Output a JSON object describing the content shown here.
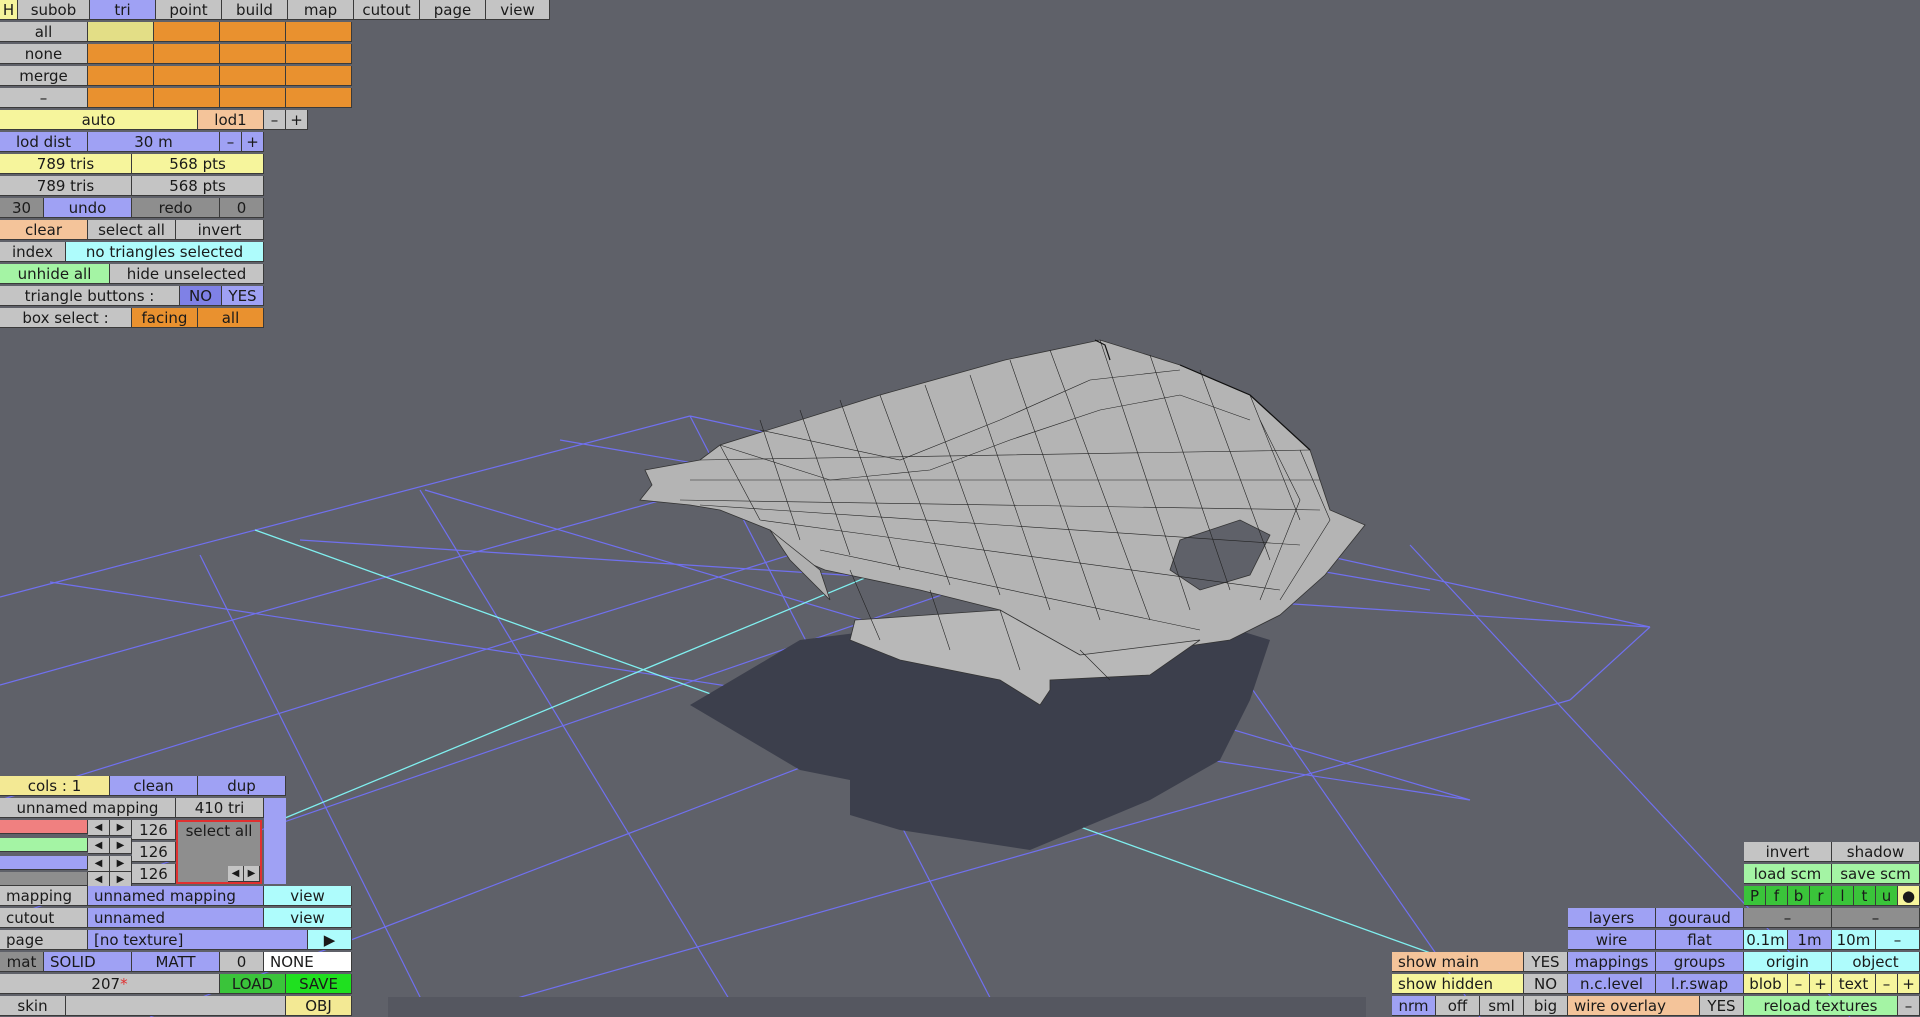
{
  "toolbar": {
    "h": "H",
    "tabs": [
      "subob",
      "tri",
      "point",
      "build",
      "map",
      "cutout",
      "page",
      "view"
    ]
  },
  "selection": {
    "rows": [
      "all",
      "none",
      "merge",
      "–"
    ],
    "lod_auto": "auto",
    "lod_name": "lod1",
    "minus": "–",
    "plus": "+",
    "lod_dist_label": "lod dist",
    "lod_dist_value": "30 m",
    "tris1": "789 tris",
    "pts1": "568 pts",
    "tris2": "789 tris",
    "pts2": "568 pts",
    "undo_count": "30",
    "undo": "undo",
    "redo": "redo",
    "redo_count": "0",
    "clear": "clear",
    "select_all": "select all",
    "invert": "invert",
    "index": "index",
    "index_status": "no triangles selected",
    "unhide_all": "unhide all",
    "hide_unselected": "hide unselected",
    "triangle_buttons": "triangle buttons :",
    "no": "NO",
    "yes": "YES",
    "box_select": "box select :",
    "facing": "facing",
    "all": "all"
  },
  "mapping_panel": {
    "cols": "cols : 1",
    "clean": "clean",
    "dup": "dup",
    "mapping_name": "unnamed mapping",
    "tri_count": "410 tri",
    "channel_values": [
      "126",
      "126",
      "126"
    ],
    "select_all": "select all",
    "arrow_left": "◀",
    "arrow_right": "▶",
    "mapping_label": "mapping",
    "mapping_value": "unnamed mapping",
    "view": "view",
    "cutout_label": "cutout",
    "cutout_value": "unnamed",
    "page_label": "page",
    "page_value": "[no texture]",
    "play": "▶",
    "mat": "mat",
    "solid": "SOLID",
    "matt": "MATT",
    "mat_num": "0",
    "none": "NONE",
    "material_id": "207",
    "asterisk": "*",
    "load": "LOAD",
    "save": "SAVE",
    "skin": "skin",
    "obj": "OBJ"
  },
  "view_panel": {
    "invert": "invert",
    "shadow": "shadow",
    "load_scm": "load scm",
    "save_scm": "save scm",
    "pfbrltu": [
      "P",
      "f",
      "b",
      "r",
      "l",
      "t",
      "u"
    ],
    "dot": "●",
    "layers": "layers",
    "gouraud": "gouraud",
    "dash": "–",
    "wire": "wire",
    "flat": "flat",
    "grid_01": "0.1m",
    "grid_1": "1m",
    "grid_10": "10m",
    "show_main": "show main",
    "show_main_val": "YES",
    "mappings": "mappings",
    "groups": "groups",
    "origin": "origin",
    "object": "object",
    "show_hidden": "show hidden",
    "show_hidden_val": "NO",
    "nc_level": "n.c.level",
    "lr_swap": "l.r.swap",
    "blob": "blob",
    "text": "text",
    "nrm": "nrm",
    "off": "off",
    "sml": "sml",
    "big": "big",
    "wire_overlay": "wire overlay",
    "wire_overlay_val": "YES",
    "reload_textures": "reload textures",
    "colors": {
      "background": "#5f6169",
      "grid": "#7070f0",
      "axis": "#80f0f0",
      "mesh_fill": "#b4b4b4",
      "shadow": "#3c3f4c"
    }
  }
}
